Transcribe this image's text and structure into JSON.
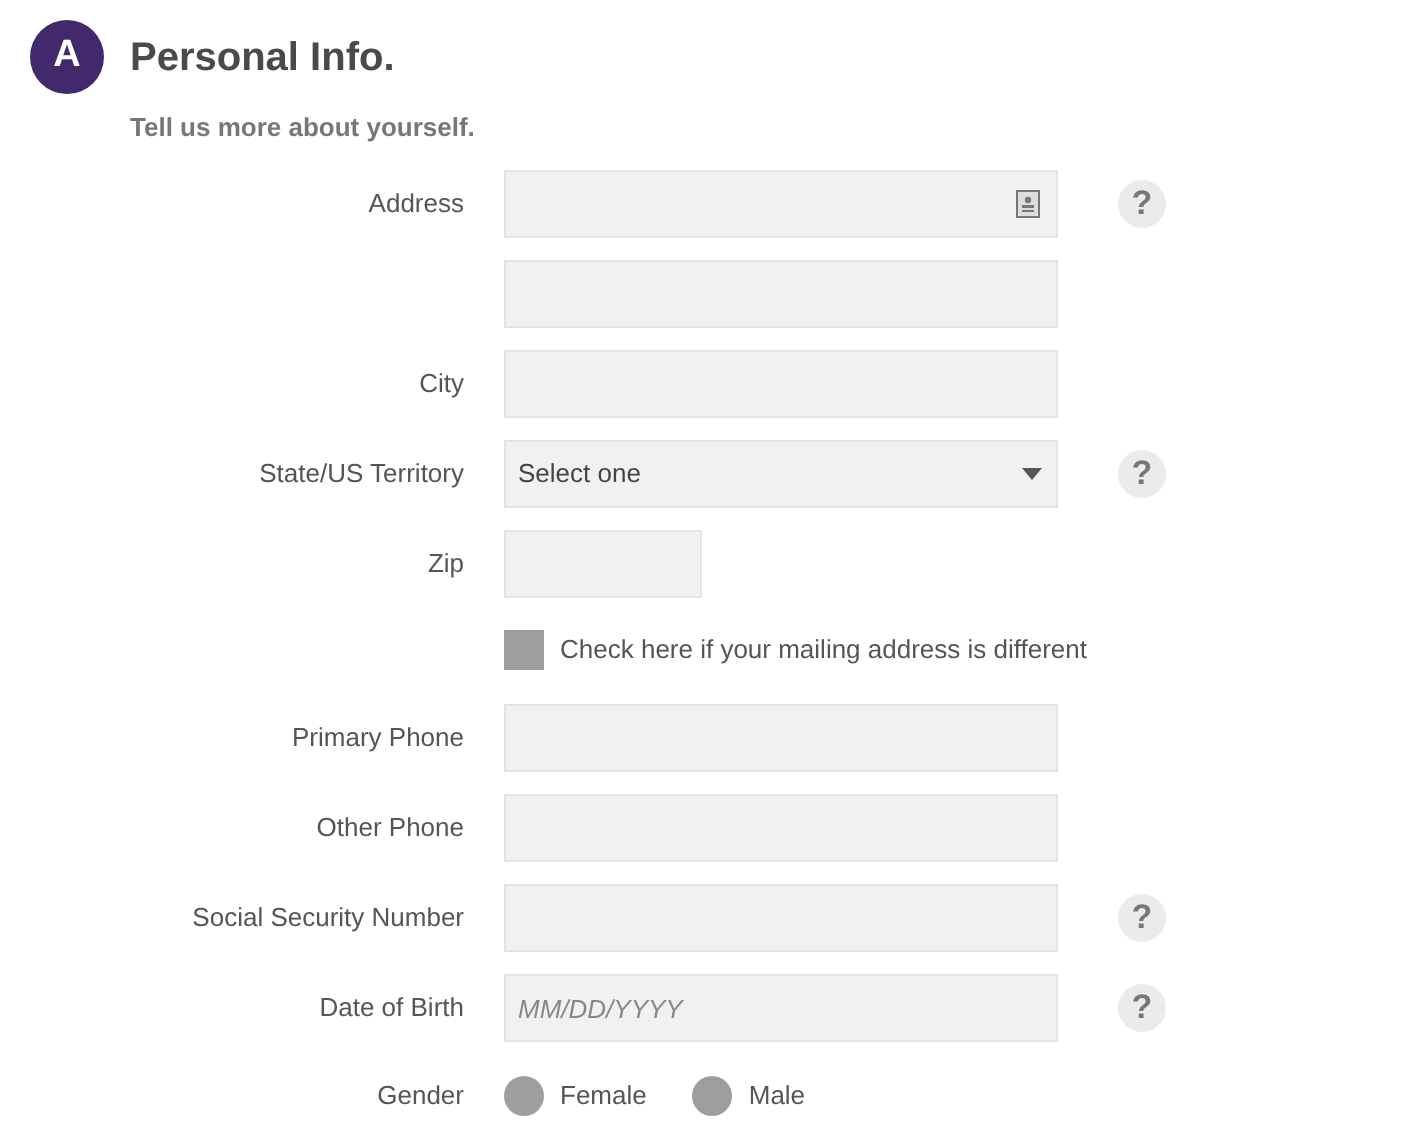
{
  "header": {
    "badge": "A",
    "title": "Personal Info.",
    "subtitle": "Tell us more about yourself."
  },
  "rows": [
    {
      "kind": "address",
      "label": "Address",
      "help": "?"
    },
    {
      "kind": "text"
    },
    {
      "kind": "text",
      "label": "City"
    },
    {
      "kind": "select",
      "label": "State/US Territory",
      "value": "Select one",
      "help": "?"
    },
    {
      "kind": "short",
      "label": "Zip"
    },
    {
      "kind": "checkbox",
      "text": "Check here if your mailing address is different",
      "checked": false
    },
    {
      "kind": "text",
      "label": "Primary Phone"
    },
    {
      "kind": "text",
      "label": "Other Phone"
    },
    {
      "kind": "text",
      "label": "Social Security Number",
      "help": "?"
    },
    {
      "kind": "text",
      "label": "Date of Birth",
      "placeholder": "MM/DD/YYYY",
      "help": "?"
    },
    {
      "kind": "radio",
      "label": "Gender",
      "options": [
        {
          "label": "Female",
          "selected": false
        },
        {
          "label": "Male",
          "selected": false
        }
      ]
    }
  ]
}
